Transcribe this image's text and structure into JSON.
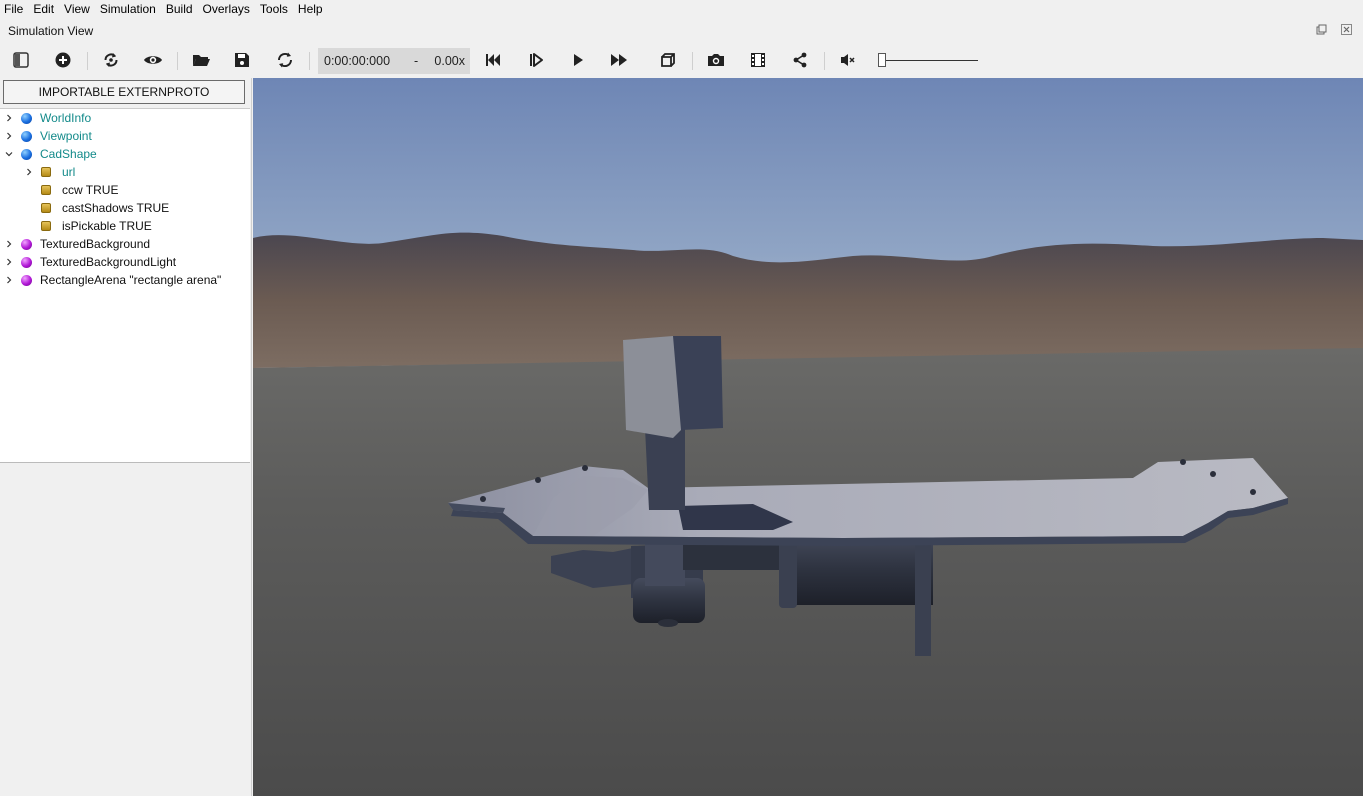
{
  "menu": [
    "File",
    "Edit",
    "View",
    "Simulation",
    "Build",
    "Overlays",
    "Tools",
    "Help"
  ],
  "panel_title": "Simulation View",
  "toolbar": {
    "icons": [
      "toggle-scene-tree-icon",
      "add-node-icon",
      "reload-world-icon",
      "eye-icon",
      "open-world-icon",
      "save-world-icon",
      "revert-icon",
      "step-back-icon",
      "step-icon",
      "play-icon",
      "fast-forward-icon",
      "cube-view-icon",
      "screenshot-icon",
      "movie-icon",
      "share-icon",
      "mute-icon"
    ],
    "time": "0:00:00:000",
    "time_sep": "-",
    "speed": "0.00x",
    "volume": 0
  },
  "left": {
    "externproto_button": "IMPORTABLE EXTERNPROTO",
    "tree": [
      {
        "label": "WorldInfo",
        "type": "proto",
        "icon": "blue-node-icon",
        "expanded": false
      },
      {
        "label": "Viewpoint",
        "type": "proto",
        "icon": "blue-node-icon",
        "expanded": false
      },
      {
        "label": "CadShape",
        "type": "proto",
        "icon": "blue-node-icon",
        "expanded": true
      },
      {
        "label": "url",
        "type": "proto-field",
        "icon": "field-icon",
        "expanded": false
      },
      {
        "label": "ccw TRUE",
        "type": "field",
        "icon": "field-icon"
      },
      {
        "label": "castShadows TRUE",
        "type": "field",
        "icon": "field-icon"
      },
      {
        "label": "isPickable TRUE",
        "type": "field",
        "icon": "field-icon"
      },
      {
        "label": "TexturedBackground",
        "type": "node",
        "icon": "purple-node-icon",
        "expanded": false
      },
      {
        "label": "TexturedBackgroundLight",
        "type": "node",
        "icon": "purple-node-icon",
        "expanded": false
      },
      {
        "label": "RectangleArena \"rectangle arena\"",
        "type": "node",
        "icon": "purple-node-icon",
        "expanded": false
      }
    ]
  },
  "colors": {
    "proto_text": "#138a8a",
    "sky_top": "#6e86b5",
    "ground": "#555555",
    "model": "#3c4356"
  }
}
